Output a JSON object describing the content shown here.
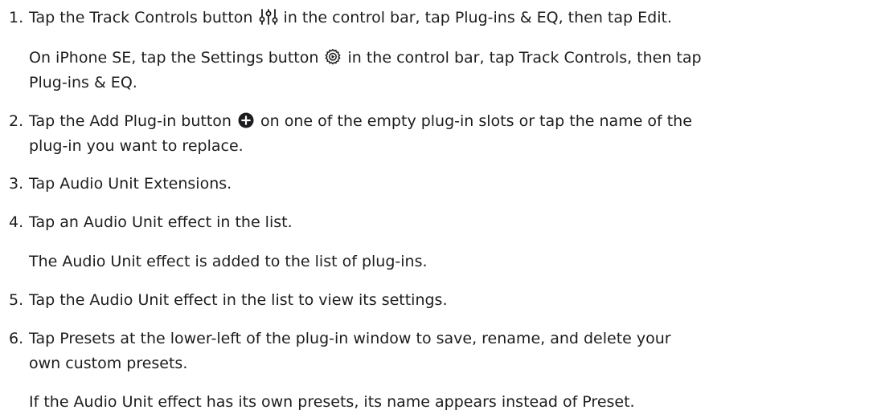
{
  "steps": [
    {
      "number": "1.",
      "lines": [
        {
          "before": "Tap the Track Controls button ",
          "icon": "sliders-icon",
          "after": " in the control bar, tap Plug-ins & EQ, then tap Edit."
        },
        {
          "before": "On iPhone SE, tap the Settings button ",
          "icon": "settings-gear-icon",
          "after": " in the control bar, tap Track Controls, then tap"
        },
        {
          "text": "Plug-ins & EQ."
        }
      ]
    },
    {
      "number": "2.",
      "lines": [
        {
          "before": "Tap the Add Plug-in button ",
          "icon": "add-circle-icon",
          "after": " on one of the empty plug-in slots or tap the name of the"
        },
        {
          "text": "plug-in you want to replace."
        }
      ]
    },
    {
      "number": "3.",
      "lines": [
        {
          "text": "Tap Audio Unit Extensions."
        }
      ]
    },
    {
      "number": "4.",
      "lines": [
        {
          "text": "Tap an Audio Unit effect in the list."
        },
        {
          "text": "The Audio Unit effect is added to the list of plug-ins."
        }
      ]
    },
    {
      "number": "5.",
      "lines": [
        {
          "text": "Tap the Audio Unit effect in the list to view its settings."
        }
      ]
    },
    {
      "number": "6.",
      "lines": [
        {
          "text": "Tap Presets at the lower-left of the plug-in window to save, rename, and delete your"
        },
        {
          "text": "own custom presets."
        },
        {
          "text": "If the Audio Unit effect has its own presets, its name appears instead of Preset."
        }
      ]
    }
  ]
}
